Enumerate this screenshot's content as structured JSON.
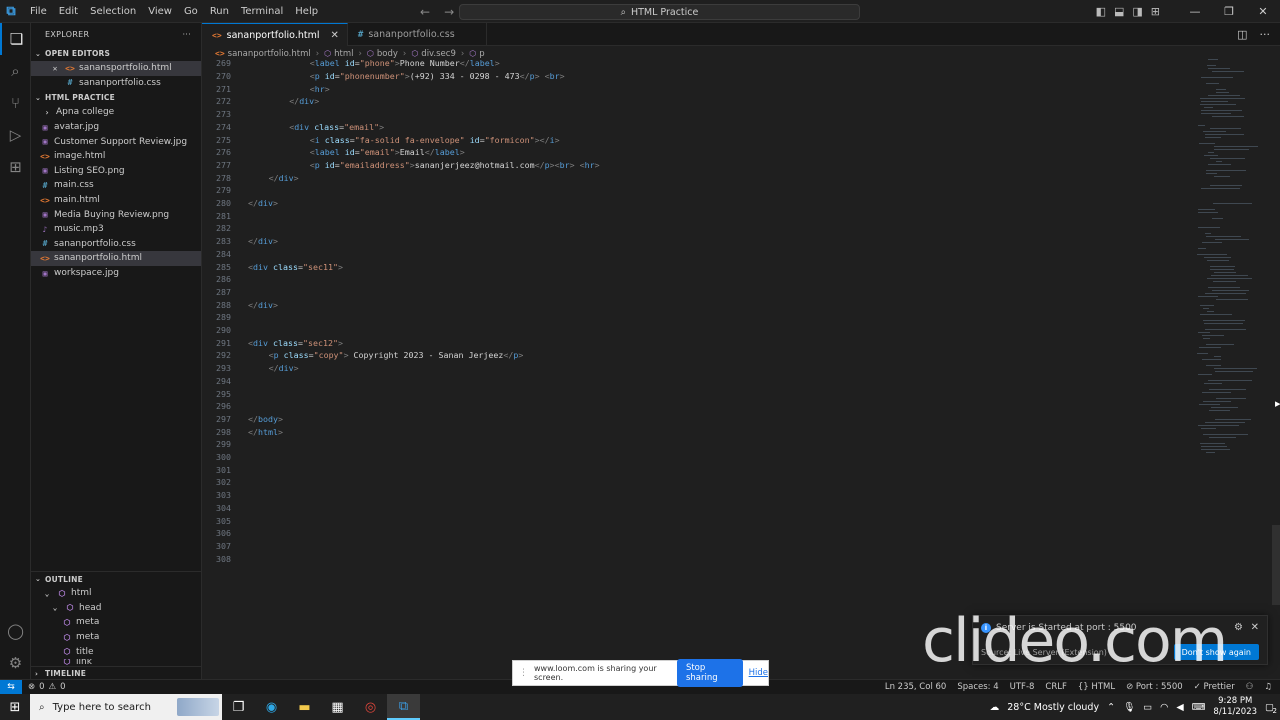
{
  "titlebar": {
    "menus": [
      "File",
      "Edit",
      "Selection",
      "View",
      "Go",
      "Run",
      "Terminal",
      "Help"
    ],
    "command_center": "HTML Practice"
  },
  "explorer": {
    "title": "EXPLORER",
    "open_editors_label": "OPEN EDITORS",
    "open_editors": [
      {
        "name": "sanansportfolio.html",
        "type": "html"
      },
      {
        "name": "sananportfolio.css",
        "type": "css"
      }
    ],
    "workspace_label": "HTML PRACTICE",
    "files": [
      {
        "name": "Apna college",
        "type": "folder"
      },
      {
        "name": "avatar.jpg",
        "type": "img"
      },
      {
        "name": "Customer Support Review.jpg",
        "type": "img"
      },
      {
        "name": "image.html",
        "type": "html"
      },
      {
        "name": "Listing SEO.png",
        "type": "img"
      },
      {
        "name": "main.css",
        "type": "css"
      },
      {
        "name": "main.html",
        "type": "html"
      },
      {
        "name": "Media Buying Review.png",
        "type": "img"
      },
      {
        "name": "music.mp3",
        "type": "mp3"
      },
      {
        "name": "sananportfolio.css",
        "type": "css"
      },
      {
        "name": "sananportfolio.html",
        "type": "html"
      },
      {
        "name": "workspace.jpg",
        "type": "img"
      }
    ],
    "outline_label": "OUTLINE",
    "outline": [
      {
        "name": "html",
        "level": 1
      },
      {
        "name": "head",
        "level": 2
      },
      {
        "name": "meta",
        "level": 3
      },
      {
        "name": "meta",
        "level": 3
      },
      {
        "name": "title",
        "level": 3
      },
      {
        "name": "link",
        "level": 3
      }
    ],
    "timeline_label": "TIMELINE"
  },
  "tabs": [
    {
      "label": "sananportfolio.html",
      "type": "html",
      "active": true
    },
    {
      "label": "sananportfolio.css",
      "type": "css",
      "active": false
    }
  ],
  "breadcrumb": [
    "sananportfolio.html",
    "html",
    "body",
    "div.sec9",
    "p"
  ],
  "code_lines": [
    {
      "n": "269",
      "indent": 3,
      "html": "<span class='t-br'>&lt;</span><span class='t-tag'>label</span> <span class='t-attr'>id</span>=<span class='t-val'>\"phone\"</span><span class='t-br'>&gt;</span><span class='t-txt'>Phone Number</span><span class='t-br'>&lt;/</span><span class='t-tag'>label</span><span class='t-br'>&gt;</span>"
    },
    {
      "n": "270",
      "indent": 3,
      "html": "<span class='t-br'>&lt;</span><span class='t-tag'>p</span> <span class='t-attr'>id</span>=<span class='t-val'>\"phonenumber\"</span><span class='t-br'>&gt;</span><span class='t-txt'>(+92) 334 - 0298 - 473</span><span class='t-br'>&lt;/</span><span class='t-tag'>p</span><span class='t-br'>&gt;</span> <span class='t-br'>&lt;</span><span class='t-tag'>br</span><span class='t-br'>&gt;</span>"
    },
    {
      "n": "271",
      "indent": 3,
      "html": "<span class='t-br'>&lt;</span><span class='t-tag'>hr</span><span class='t-br'>&gt;</span>"
    },
    {
      "n": "272",
      "indent": 2,
      "html": "<span class='t-br'>&lt;/</span><span class='t-tag'>div</span><span class='t-br'>&gt;</span>"
    },
    {
      "n": "273",
      "indent": 0,
      "html": ""
    },
    {
      "n": "274",
      "indent": 2,
      "html": "<span class='t-br'>&lt;</span><span class='t-tag'>div</span> <span class='t-attr'>class</span>=<span class='t-val'>\"email\"</span><span class='t-br'>&gt;</span>"
    },
    {
      "n": "275",
      "indent": 3,
      "html": "<span class='t-br'>&lt;</span><span class='t-tag'>i</span> <span class='t-attr'>class</span>=<span class='t-val'>\"fa-solid fa-envelope\"</span> <span class='t-attr'>id</span>=<span class='t-val'>\"formicon\"</span><span class='t-br'>&gt;&lt;/</span><span class='t-tag'>i</span><span class='t-br'>&gt;</span>"
    },
    {
      "n": "276",
      "indent": 3,
      "html": "<span class='t-br'>&lt;</span><span class='t-tag'>label</span> <span class='t-attr'>id</span>=<span class='t-val'>\"email\"</span><span class='t-br'>&gt;</span><span class='t-txt'>Email</span><span class='t-br'>&lt;/</span><span class='t-tag'>label</span><span class='t-br'>&gt;</span>"
    },
    {
      "n": "277",
      "indent": 3,
      "html": "<span class='t-br'>&lt;</span><span class='t-tag'>p</span> <span class='t-attr'>id</span>=<span class='t-val'>\"emailaddress\"</span><span class='t-br'>&gt;</span><span class='t-txt'>sananjerjeez@hotmail.com</span><span class='t-br'>&lt;/</span><span class='t-tag'>p</span><span class='t-br'>&gt;&lt;</span><span class='t-tag'>br</span><span class='t-br'>&gt;</span> <span class='t-br'>&lt;</span><span class='t-tag'>hr</span><span class='t-br'>&gt;</span>"
    },
    {
      "n": "278",
      "indent": 1,
      "html": "<span class='t-br'>&lt;/</span><span class='t-tag'>div</span><span class='t-br'>&gt;</span>"
    },
    {
      "n": "279",
      "indent": 0,
      "html": ""
    },
    {
      "n": "280",
      "indent": 0,
      "html": "<span class='t-br'>&lt;/</span><span class='t-tag'>div</span><span class='t-br'>&gt;</span>"
    },
    {
      "n": "281",
      "indent": 0,
      "html": ""
    },
    {
      "n": "282",
      "indent": 0,
      "html": ""
    },
    {
      "n": "283",
      "indent": 0,
      "html": "<span class='t-br'>&lt;/</span><span class='t-tag'>div</span><span class='t-br'>&gt;</span>"
    },
    {
      "n": "284",
      "indent": 0,
      "html": ""
    },
    {
      "n": "285",
      "indent": 0,
      "html": "<span class='t-br'>&lt;</span><span class='t-tag'>div</span> <span class='t-attr'>class</span>=<span class='t-val'>\"sec11\"</span><span class='t-br'>&gt;</span>"
    },
    {
      "n": "286",
      "indent": 0,
      "html": ""
    },
    {
      "n": "287",
      "indent": 0,
      "html": ""
    },
    {
      "n": "288",
      "indent": 0,
      "html": "<span class='t-br'>&lt;/</span><span class='t-tag'>div</span><span class='t-br'>&gt;</span>"
    },
    {
      "n": "289",
      "indent": 0,
      "html": ""
    },
    {
      "n": "290",
      "indent": 0,
      "html": ""
    },
    {
      "n": "291",
      "indent": 0,
      "html": "<span class='t-br'>&lt;</span><span class='t-tag'>div</span> <span class='t-attr'>class</span>=<span class='t-val'>\"sec12\"</span><span class='t-br'>&gt;</span>"
    },
    {
      "n": "292",
      "indent": 1,
      "html": "<span class='t-br'>&lt;</span><span class='t-tag'>p</span> <span class='t-attr'>class</span>=<span class='t-val'>\"copy\"</span><span class='t-br'>&gt;</span><span class='t-txt'> Copyright 2023 - Sanan Jerjeez</span><span class='t-br'>&lt;/</span><span class='t-tag'>p</span><span class='t-br'>&gt;</span>"
    },
    {
      "n": "293",
      "indent": 1,
      "html": "<span class='t-br'>&lt;/</span><span class='t-tag'>div</span><span class='t-br'>&gt;</span>"
    },
    {
      "n": "294",
      "indent": 0,
      "html": ""
    },
    {
      "n": "295",
      "indent": 0,
      "html": ""
    },
    {
      "n": "296",
      "indent": 0,
      "html": ""
    },
    {
      "n": "297",
      "indent": 0,
      "html": "<span class='t-br'>&lt;/</span><span class='t-tag'>body</span><span class='t-br'>&gt;</span>"
    },
    {
      "n": "298",
      "indent": 0,
      "html": "<span class='t-br'>&lt;/</span><span class='t-tag'>html</span><span class='t-br'>&gt;</span>"
    },
    {
      "n": "299",
      "indent": 0,
      "html": ""
    },
    {
      "n": "300",
      "indent": 0,
      "html": ""
    },
    {
      "n": "301",
      "indent": 0,
      "html": ""
    },
    {
      "n": "302",
      "indent": 0,
      "html": ""
    },
    {
      "n": "303",
      "indent": 0,
      "html": ""
    },
    {
      "n": "304",
      "indent": 0,
      "html": ""
    },
    {
      "n": "305",
      "indent": 0,
      "html": ""
    },
    {
      "n": "306",
      "indent": 0,
      "html": ""
    },
    {
      "n": "307",
      "indent": 0,
      "html": ""
    },
    {
      "n": "308",
      "indent": 0,
      "html": ""
    }
  ],
  "statusbar": {
    "problems": "0",
    "warnings": "0",
    "position": "Ln 235, Col 60",
    "spaces": "Spaces: 4",
    "encoding": "UTF-8",
    "eol": "CRLF",
    "language": "HTML",
    "port": "Port : 5500",
    "formatter": "Prettier"
  },
  "notification": {
    "message": "Server is Started at port : 5500",
    "source": "Source: Live Server (Extension)",
    "button": "Don't show again"
  },
  "loom": {
    "message": "www.loom.com is sharing your screen.",
    "stop_label": "Stop sharing",
    "hide_label": "Hide"
  },
  "watermark": "clideo.com",
  "taskbar": {
    "search_placeholder": "Type here to search",
    "weather": "28°C  Mostly cloudy",
    "time": "9:28 PM",
    "date": "8/11/2023",
    "notification_count": "2"
  },
  "colors": {
    "accent": "#0078d4",
    "tag": "#569cd6",
    "attr": "#9cdcfe",
    "string": "#ce9178"
  }
}
